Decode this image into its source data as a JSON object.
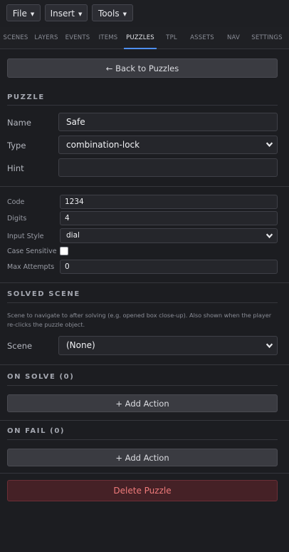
{
  "menus": {
    "file": "File",
    "insert": "Insert",
    "tools": "Tools"
  },
  "tabs": [
    "SCENES",
    "LAYERS",
    "EVENTS",
    "ITEMS",
    "PUZZLES",
    "TPL",
    "ASSETS",
    "NAV",
    "SETTINGS"
  ],
  "active_tab": "PUZZLES",
  "back_button": "← Back to Puzzles",
  "puzzle": {
    "section_title": "PUZZLE",
    "name_label": "Name",
    "name_value": "Safe",
    "type_label": "Type",
    "type_value": "combination-lock",
    "hint_label": "Hint",
    "hint_value": ""
  },
  "lock": {
    "code_label": "Code",
    "code_value": "1234",
    "digits_label": "Digits",
    "digits_value": "4",
    "input_style_label": "Input Style",
    "input_style_value": "dial",
    "case_sensitive_label": "Case Sensitive",
    "case_sensitive_checked": false,
    "max_attempts_label": "Max Attempts",
    "max_attempts_value": "0"
  },
  "solved_scene": {
    "section_title": "SOLVED SCENE",
    "description": "Scene to navigate to after solving (e.g. opened box close-up). Also shown when the player re-clicks the puzzle object.",
    "scene_label": "Scene",
    "scene_value": "(None)"
  },
  "on_solve": {
    "section_title": "ON SOLVE (0)",
    "add_action": "+ Add Action"
  },
  "on_fail": {
    "section_title": "ON FAIL (0)",
    "add_action": "+ Add Action"
  },
  "delete_button": "Delete Puzzle",
  "colors": {
    "accent": "#4f8ff0",
    "danger_text": "#f07b7b",
    "danger_bg": "#452126",
    "background": "#1c1d21"
  }
}
